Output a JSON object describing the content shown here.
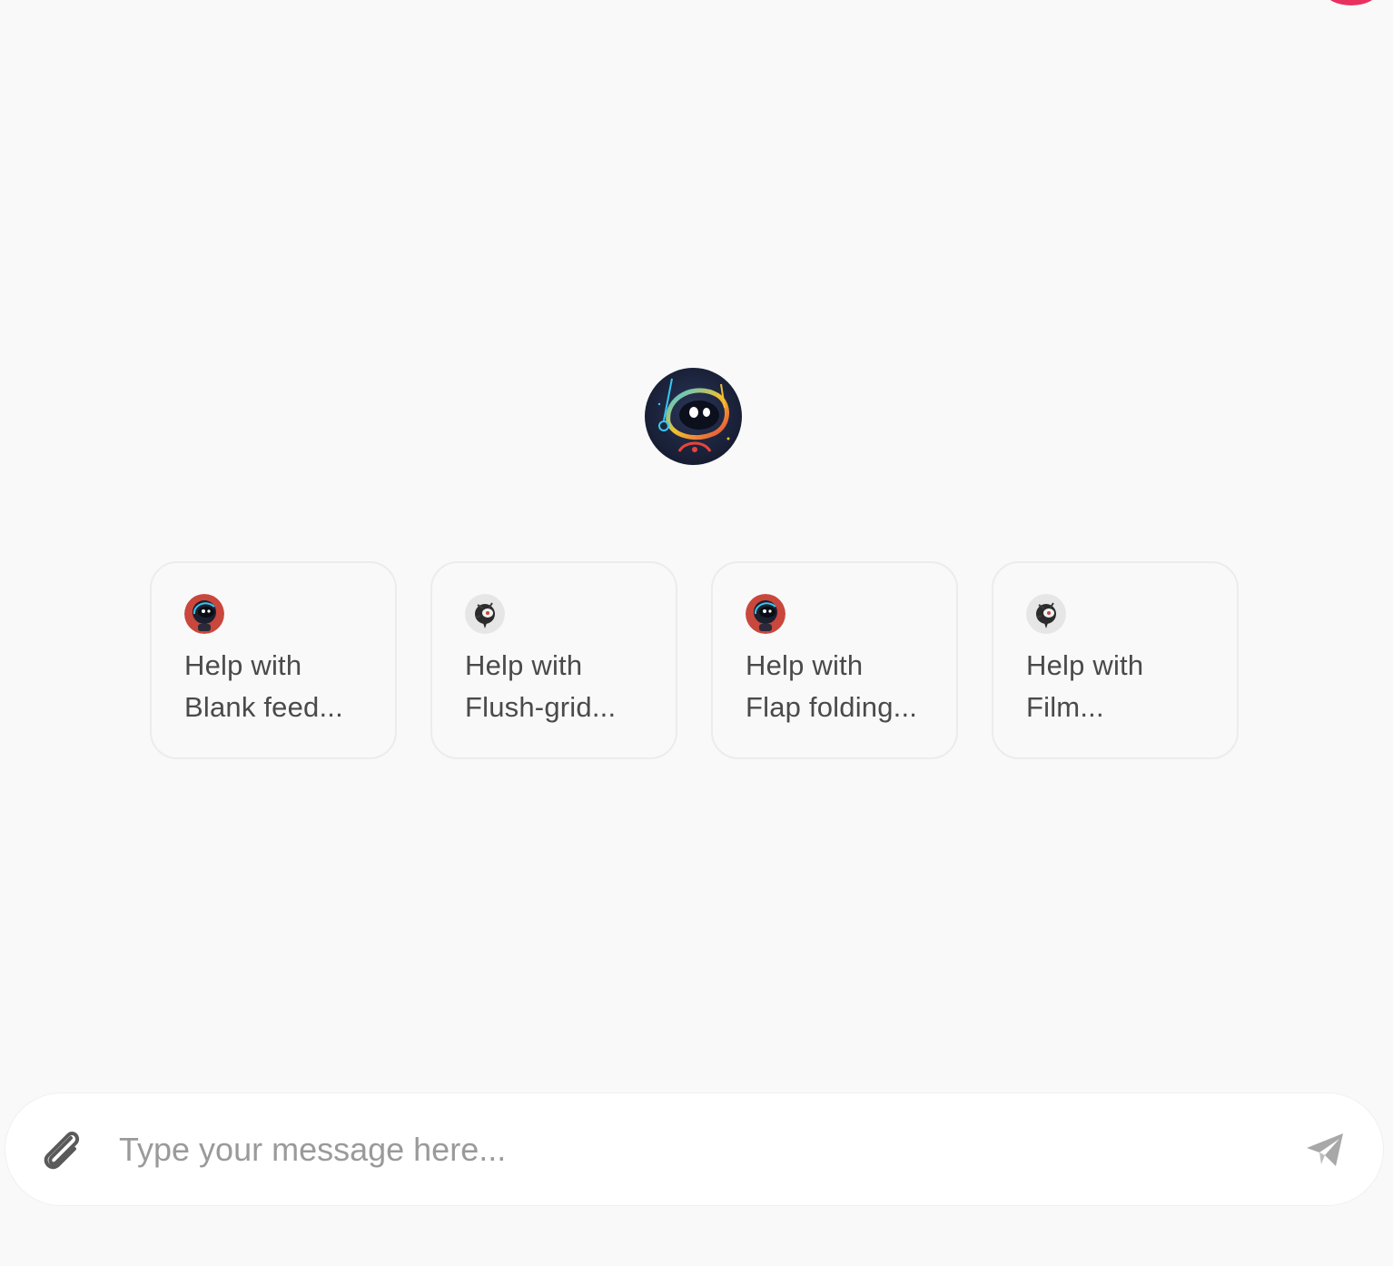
{
  "colors": {
    "background": "#f9f9f9",
    "corner_badge": "#e8315f",
    "card_border": "#ececec",
    "text": "#4a4a4a",
    "placeholder": "#9a9a9a",
    "send_icon": "#a8a8a8"
  },
  "hero": {
    "icon": "robot-avatar-icon"
  },
  "suggestions": [
    {
      "icon": "red-robot-avatar-icon",
      "line1": "Help with",
      "line2": "Blank feed..."
    },
    {
      "icon": "grey-robot-avatar-icon",
      "line1": "Help with",
      "line2": "Flush-grid..."
    },
    {
      "icon": "red-robot-avatar-icon",
      "line1": "Help with",
      "line2": "Flap folding..."
    },
    {
      "icon": "grey-robot-avatar-icon",
      "line1": "Help with",
      "line2": "Film..."
    }
  ],
  "composer": {
    "placeholder": "Type your message here...",
    "value": "",
    "attach_icon": "paperclip-icon",
    "send_icon": "paper-plane-icon"
  }
}
